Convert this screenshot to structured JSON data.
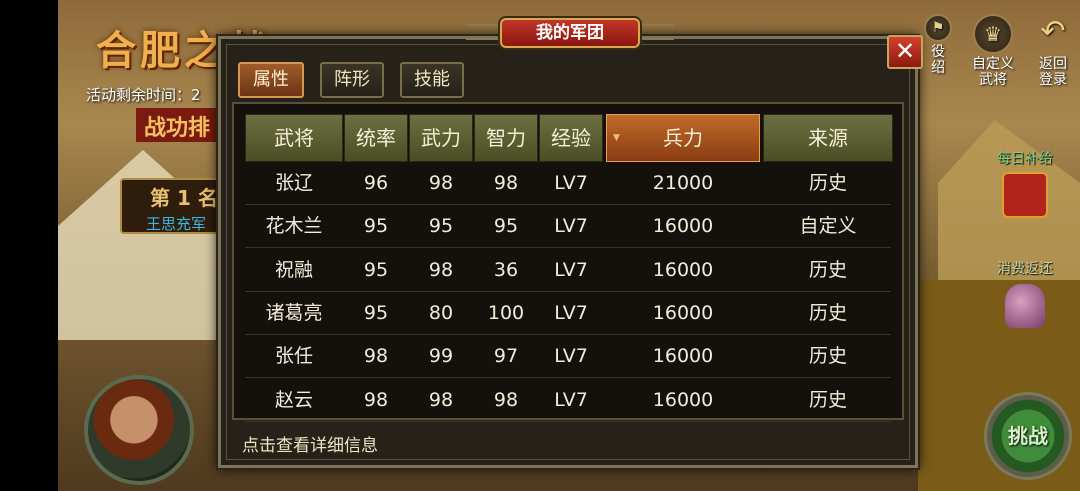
{
  "background": {
    "event_title": "合肥之战",
    "event_timer": "活动剩余时间：2",
    "merit_banner": "战功排",
    "rank_label": "第 1 名",
    "rank_name": "王思充军"
  },
  "side_menu": {
    "service": "役绍",
    "custom_general": "自定义\n武将",
    "back_login": "返回\n登录",
    "daily_supply": "每日补给",
    "consume_rebate": "消费返还",
    "challenge": "挑战"
  },
  "dialog": {
    "title": "我的军团",
    "close": "✕",
    "tabs": [
      "属性",
      "阵形",
      "技能"
    ],
    "active_tab": "属性",
    "columns": [
      "武将",
      "统率",
      "武力",
      "智力",
      "经验",
      "兵力",
      "来源"
    ],
    "sorted_column": "兵力",
    "rows": [
      {
        "name": "张辽",
        "command": "96",
        "force": "98",
        "intellect": "98",
        "exp": "LV7",
        "troops": "21000",
        "source": "历史"
      },
      {
        "name": "花木兰",
        "command": "95",
        "force": "95",
        "intellect": "95",
        "exp": "LV7",
        "troops": "16000",
        "source": "自定义"
      },
      {
        "name": "祝融",
        "command": "95",
        "force": "98",
        "intellect": "36",
        "exp": "LV7",
        "troops": "16000",
        "source": "历史"
      },
      {
        "name": "诸葛亮",
        "command": "95",
        "force": "80",
        "intellect": "100",
        "exp": "LV7",
        "troops": "16000",
        "source": "历史"
      },
      {
        "name": "张任",
        "command": "98",
        "force": "99",
        "intellect": "97",
        "exp": "LV7",
        "troops": "16000",
        "source": "历史"
      },
      {
        "name": "赵云",
        "command": "98",
        "force": "98",
        "intellect": "98",
        "exp": "LV7",
        "troops": "16000",
        "source": "历史"
      }
    ],
    "footer_hint": "点击查看详细信息"
  },
  "colors": {
    "title_red": "#c23528",
    "header_olive": "#6c7040",
    "header_active": "#c06a2a",
    "panel_bg": "#262219"
  }
}
